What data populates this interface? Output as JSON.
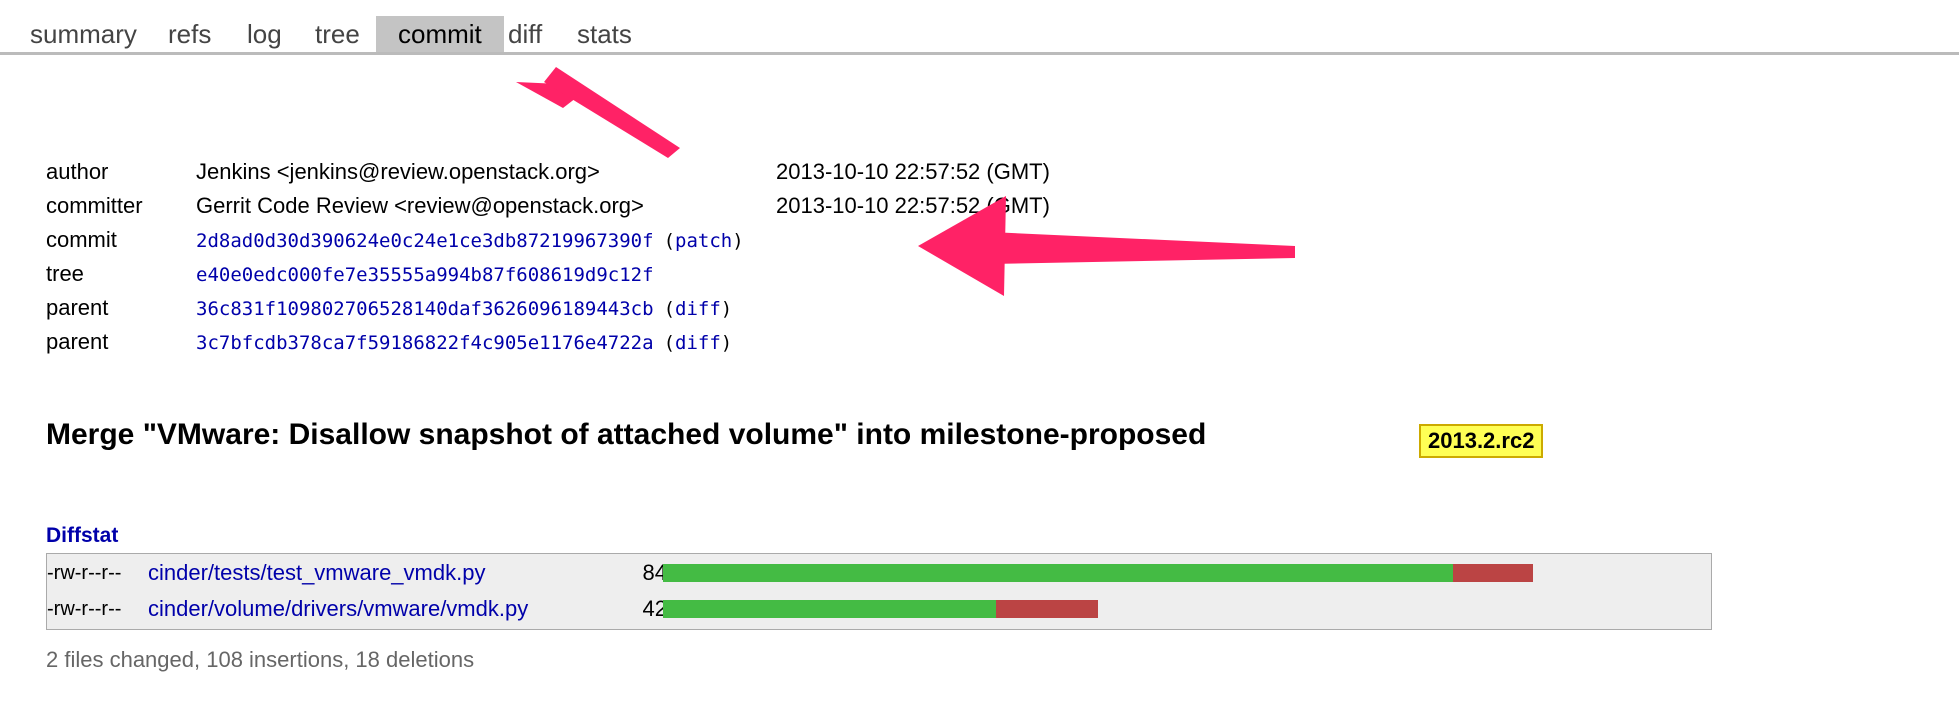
{
  "tabs": [
    {
      "label": "summary"
    },
    {
      "label": "refs"
    },
    {
      "label": "log"
    },
    {
      "label": "tree"
    },
    {
      "label": "commit",
      "active": true
    },
    {
      "label": "diff"
    },
    {
      "label": "stats"
    }
  ],
  "meta": {
    "author_label": "author",
    "author_value": "Jenkins <jenkins@review.openstack.org>",
    "author_date": "2013-10-10 22:57:52 (GMT)",
    "committer_label": "committer",
    "committer_value": "Gerrit Code Review <review@openstack.org>",
    "committer_date": "2013-10-10 22:57:52 (GMT)",
    "commit_label": "commit",
    "commit_sha": "2d8ad0d30d390624e0c24e1ce3db87219967390f",
    "commit_link": "patch",
    "tree_label": "tree",
    "tree_sha": "e40e0edc000fe7e35555a994b87f608619d9c12f",
    "parent1_label": "parent",
    "parent1_sha": "36c831f109802706528140daf3626096189443cb",
    "parent1_link": "diff",
    "parent2_label": "parent",
    "parent2_sha": "3c7bfcdb378ca7f59186822f4c905e1176e4722a",
    "parent2_link": "diff"
  },
  "subject": "Merge \"VMware: Disallow snapshot of attached volume\" into milestone-proposed",
  "tag": "2013.2.rc2",
  "diffstat": {
    "title": "Diffstat",
    "files": [
      {
        "mode": "-rw-r--r--",
        "path": "cinder/tests/test_vmware_vmdk.py",
        "count": "84",
        "insert_fraction": 0.908,
        "delete_fraction": 0.092
      },
      {
        "mode": "-rw-r--r--",
        "path": "cinder/volume/drivers/vmware/vmdk.py",
        "count": "42",
        "insert_fraction": 0.766,
        "delete_fraction": 0.234
      }
    ],
    "summary": "2 files changed, 108 insertions, 18 deletions"
  },
  "colors": {
    "insert": "#44bb44",
    "delete": "#bb4444",
    "arrow": "#ff2266"
  }
}
